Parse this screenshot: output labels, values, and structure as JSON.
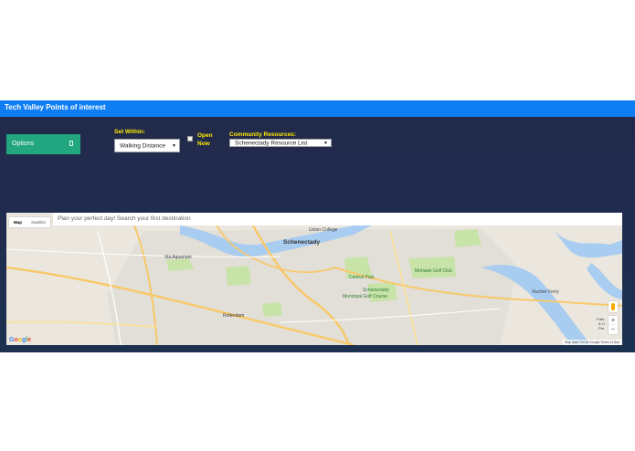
{
  "header": {
    "title": "Tech Valley Points of interest"
  },
  "controls": {
    "options_label": "Options",
    "set_within_label": "Set Within:",
    "distance_value": "Walking Distance",
    "open_now_label": "Open Now",
    "community_label": "Community Resources:",
    "resource_value": "Schenectady Resource List"
  },
  "map": {
    "search_placeholder": "Plan your perfect day! Search your first destination",
    "type_map": "Map",
    "type_satellite": "Satellite",
    "labels": {
      "union_college": "Union College",
      "schenectady": "Schenectady",
      "via_aquarium": "Via Aquarium",
      "central_park": "Central Park",
      "municipal_golf_1": "Schenectady",
      "municipal_golf_2": "Municipal Golf Course",
      "mohawk_golf": "Mohawk Golf Club",
      "rotterdam": "Rotterdam",
      "vischer_ferry": "Vischer Ferry",
      "right_edge_1": "Falls",
      "right_edge_2": "& H",
      "right_edge_3": "Pre"
    },
    "google_letters": [
      "G",
      "o",
      "o",
      "g",
      "l",
      "e"
    ],
    "attribution": "Map data ©2018 Google     Terms of Use",
    "zoom_in": "+",
    "zoom_out": "−"
  },
  "colors": {
    "title_bar": "#0f7ef4",
    "options_button": "#21a67f",
    "label_yellow": "#ffea00",
    "background": "#1f2c4e",
    "water": "#a9cdf0",
    "park": "#c8e3a8",
    "highway": "#f7c96a"
  }
}
